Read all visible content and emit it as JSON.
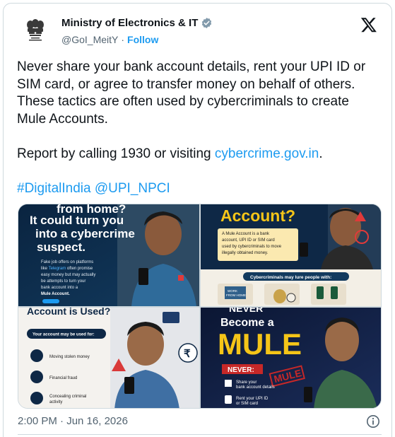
{
  "account": {
    "name": "Ministry of Electronics & IT",
    "handle": "@GoI_MeitY",
    "separator": "·",
    "follow_label": "Follow"
  },
  "tweet": {
    "paragraph1": "Never share your bank account details, rent your UPI ID or SIM card, or agree to transfer money on behalf of others. These tactics are often used by cybercriminals to create Mule Accounts.",
    "report_prefix": "Report by calling 1930 or visiting ",
    "report_link": "cybercrime.gov.in",
    "report_suffix": ".",
    "hashtag": "#DigitalIndia",
    "mention": "@UPI_NPCI"
  },
  "media": {
    "image1": {
      "line1": "from home?",
      "line2": "It could turn you",
      "line3": "into a cybercrime",
      "line4": "suspect.",
      "body1": "Fake job offers on platforms",
      "body2a": "like ",
      "body2b": "Telegram",
      "body2c": " often promise",
      "body3": "easy money but may actually",
      "body4": "be attempts to turn your",
      "body5": "bank account into a",
      "body6": "Mule Account."
    },
    "image2": {
      "title": "Account?",
      "body1": "A Mule Account is a bank",
      "body2": "account, UPI ID or SIM card",
      "body3": "used by cybercriminals to move",
      "body4": "illegally obtained money.",
      "lure": "Cybercriminals may lure people with:",
      "laptop1": "WORK",
      "laptop2": "FROM HOME"
    },
    "image3": {
      "title": "Account is Used?",
      "banner": "Your account may be used for:",
      "item1": "Moving stolen money",
      "item2": "Financial fraud",
      "item3a": "Concealing criminal",
      "item3b": "activity",
      "rupee": "₹"
    },
    "image4": {
      "never_top": "NEVER",
      "become": "Become a",
      "mule": "MULE",
      "stamp": "MULE",
      "never": "NEVER:",
      "item1a": "Share your",
      "item1b": "bank account details",
      "item2a": "Rent your UPI ID",
      "item2b": "or SIM card"
    }
  },
  "footer": {
    "timestamp": "2:00 PM · Jun 16, 2026"
  },
  "colors": {
    "accent": "#1d9bf0",
    "text": "#0f1419",
    "muted": "#536471",
    "border": "#cfd9de",
    "mule_yellow": "#f5c518"
  },
  "icons": [
    "emblem-icon",
    "verified-badge-icon",
    "x-logo-icon",
    "info-icon"
  ]
}
